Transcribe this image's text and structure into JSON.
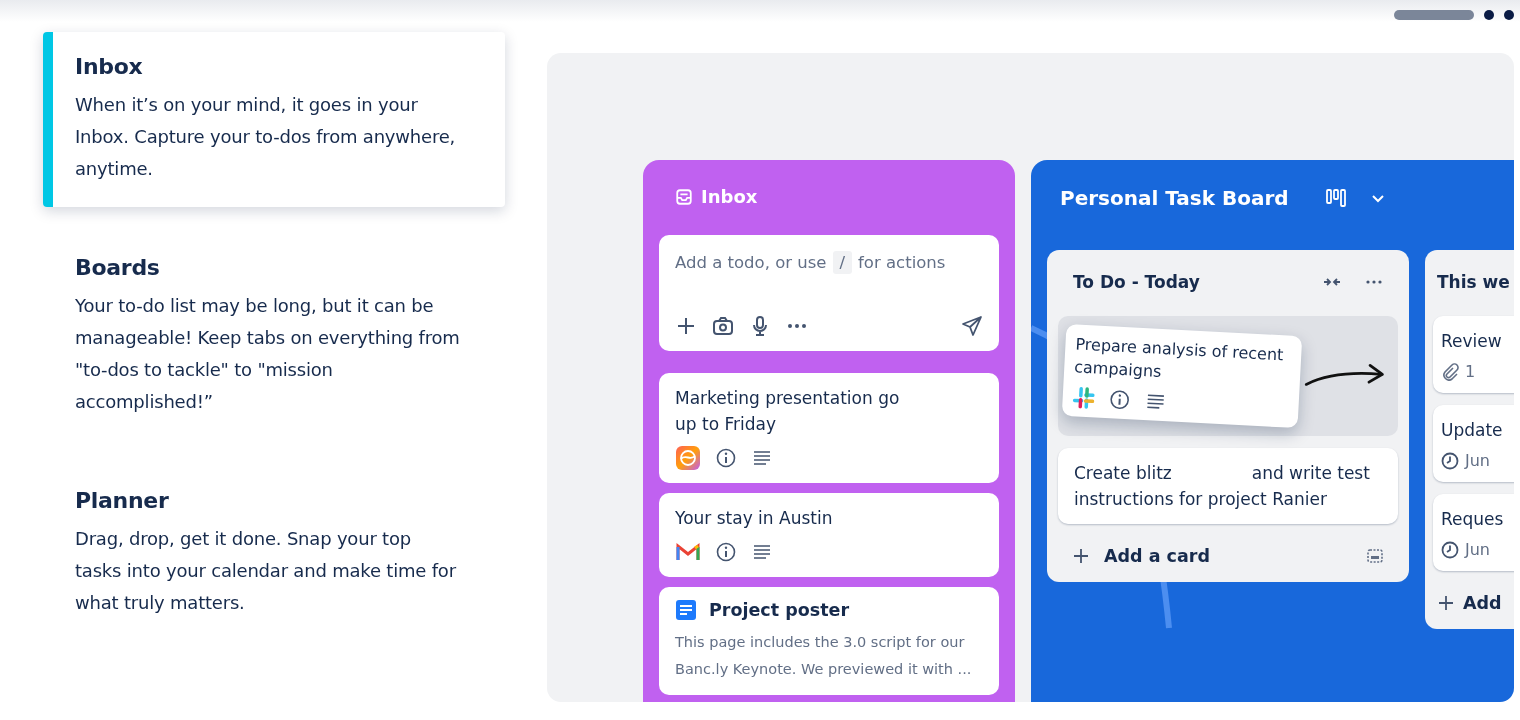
{
  "carousel": [
    {
      "selected": true
    },
    {
      "selected": false
    },
    {
      "selected": false
    }
  ],
  "features": [
    {
      "title": "Inbox",
      "body": "When it’s on your mind, it goes in your Inbox. Capture your to-dos from anywhere, anytime.",
      "selected": true
    },
    {
      "title": "Boards",
      "body": "Your to-do list may be long, but it can be manageable! Keep tabs on everything from \"to-dos to tackle\" to \"mission accomplished!”",
      "selected": false
    },
    {
      "title": "Planner",
      "body": "Drag, drop, get it done. Snap your top tasks into your calendar and make time for what truly matters.",
      "selected": false
    }
  ],
  "inbox": {
    "title": "Inbox",
    "composer": {
      "placeholder_before": "Add a todo, or use",
      "key": "/",
      "placeholder_after": "for actions"
    },
    "cards": [
      {
        "kind": "app",
        "lines": [
          "Marketing presentation go",
          "up to Friday"
        ]
      },
      {
        "kind": "email",
        "lines": [
          "Your stay in Austin"
        ]
      },
      {
        "kind": "doc",
        "lines": [
          "Project poster"
        ],
        "body": [
          "This page includes the 3.0 script for our",
          "Banc.ly Keynote. We previewed it with ..."
        ]
      }
    ]
  },
  "dragged_card": {
    "lines": [
      "Prepare analysis of recent",
      "campaigns"
    ]
  },
  "board": {
    "title": "Personal Task Board",
    "lists": [
      {
        "title": "To Do - Today",
        "cards": [
          {
            "kind": "placeholder"
          },
          {
            "kind": "text",
            "lines": [
              "Create blitz",
              "and write test",
              "instructions for project Ranier"
            ]
          }
        ],
        "add": "Add a card"
      },
      {
        "title": "This we",
        "cards": [
          {
            "kind": "attachment",
            "lines": [
              "Review"
            ],
            "meta": "1"
          },
          {
            "kind": "date",
            "lines": [
              "Update"
            ],
            "meta": "Jun"
          },
          {
            "kind": "date",
            "lines": [
              "Reques"
            ],
            "meta": "Jun"
          }
        ],
        "add": "Add"
      }
    ]
  }
}
